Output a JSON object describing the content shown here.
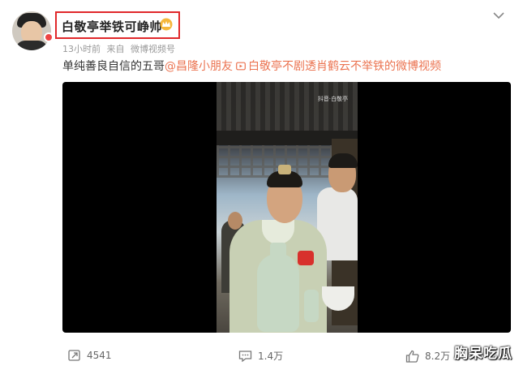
{
  "post": {
    "author_name": "白敬亭举铁可峥帅",
    "author_badge_icon": "crown-icon",
    "meta": {
      "time": "13小时前",
      "source_prefix": "来自",
      "source": "微博视频号"
    },
    "content": {
      "text": "单纯善良自信的五哥",
      "mention": "@昌隆小朋友",
      "video_link_label": "白敬亭不剧透肖鹤云不举铁的微博视频"
    },
    "video": {
      "watermark": "抖音·白敬亭"
    },
    "actions": {
      "repost_count": "4541",
      "comment_count": "1.4万",
      "like_count": "8.2万"
    }
  },
  "page_watermark": "胸呆吃瓜",
  "colors": {
    "highlight_border": "#e0282b",
    "link": "#eb7350",
    "meta": "#999999"
  }
}
